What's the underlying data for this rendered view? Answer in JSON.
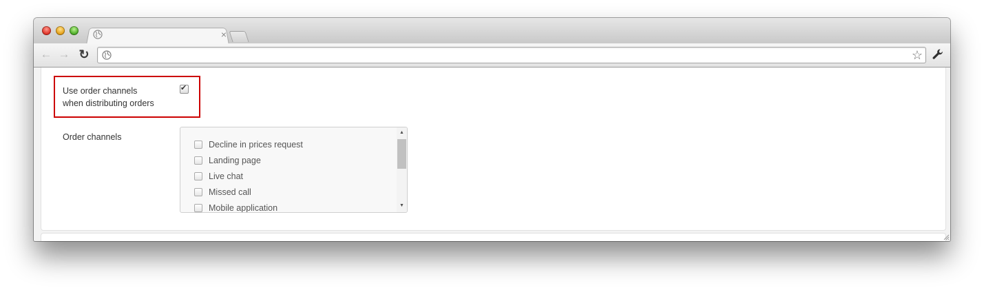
{
  "browser": {
    "tab": {
      "title": "",
      "close_glyph": "×",
      "icon": "globe-icon"
    },
    "toolbar": {
      "back_glyph": "←",
      "forward_glyph": "→",
      "reload_glyph": "↻",
      "address": "",
      "star_glyph": "☆",
      "menu_icon": "wrench-icon"
    }
  },
  "form": {
    "use_order_channels": {
      "label_line1": "Use order channels",
      "label_line2": "when distributing orders",
      "checked": true,
      "check_glyph": "✔"
    },
    "order_channels": {
      "label": "Order channels",
      "options": [
        {
          "label": "Decline in prices request",
          "checked": false
        },
        {
          "label": "Landing page",
          "checked": false
        },
        {
          "label": "Live chat",
          "checked": false
        },
        {
          "label": "Missed call",
          "checked": false
        },
        {
          "label": "Mobile application",
          "checked": false
        }
      ],
      "scroll_up_glyph": "▲",
      "scroll_down_glyph": "▼"
    }
  },
  "colors": {
    "highlight": "#cc0000"
  }
}
